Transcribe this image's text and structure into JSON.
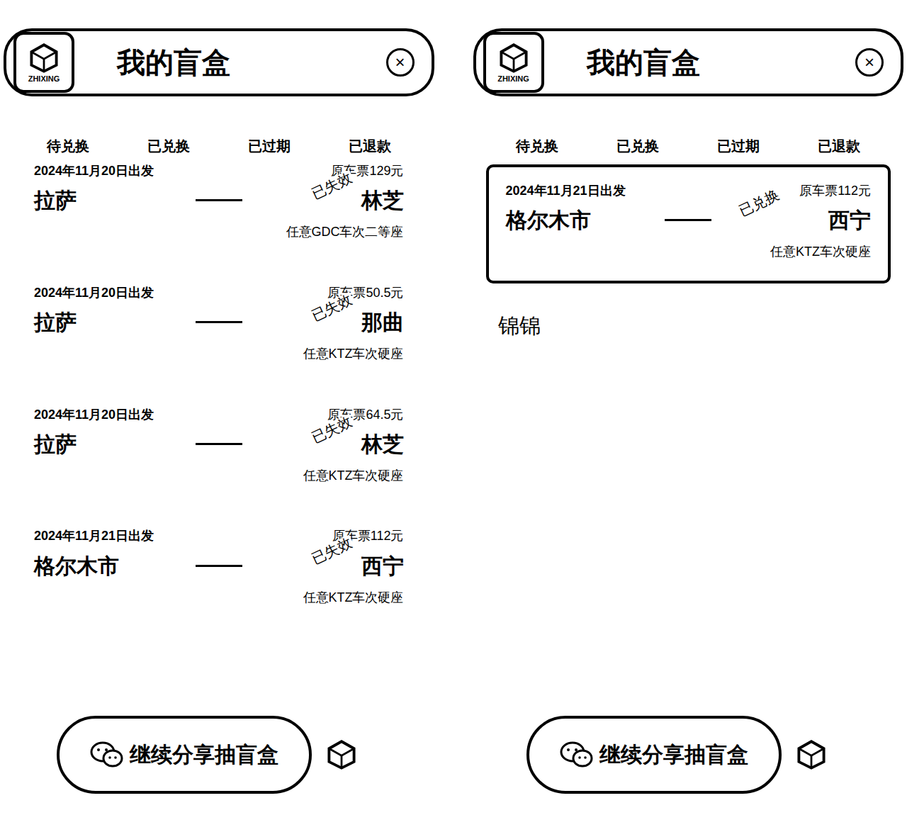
{
  "panels": [
    {
      "header": {
        "logo_text": "ZHIXING",
        "title": "我的盲盒",
        "close": "×"
      },
      "tabs": [
        {
          "label": "待兑换",
          "selected": false
        },
        {
          "label": "已兑换",
          "selected": false
        },
        {
          "label": "已过期",
          "selected": false
        },
        {
          "label": "已退款",
          "selected": false
        }
      ],
      "tickets": [
        {
          "date": "2024年11月20日出发",
          "from": "拉萨",
          "to": "林芝",
          "price": "原车票129元",
          "seat": "任意GDC车次二等座",
          "stamp": "已失效",
          "framed": false
        },
        {
          "date": "2024年11月20日出发",
          "from": "拉萨",
          "to": "那曲",
          "price": "原车票50.5元",
          "seat": "任意KTZ车次硬座",
          "stamp": "已失效",
          "framed": false
        },
        {
          "date": "2024年11月20日出发",
          "from": "拉萨",
          "to": "林芝",
          "price": "原车票64.5元",
          "seat": "任意KTZ车次硬座",
          "stamp": "已失效",
          "framed": false
        },
        {
          "date": "2024年11月21日出发",
          "from": "格尔木市",
          "to": "西宁",
          "price": "原车票112元",
          "seat": "任意KTZ车次硬座",
          "stamp": "已失效",
          "framed": false
        }
      ],
      "note": "",
      "button": "继续分享抽盲盒"
    },
    {
      "header": {
        "logo_text": "ZHIXING",
        "title": "我的盲盒",
        "close": "×"
      },
      "tabs": [
        {
          "label": "待兑换",
          "selected": false
        },
        {
          "label": "已兑换",
          "selected": false
        },
        {
          "label": "已过期",
          "selected": false
        },
        {
          "label": "已退款",
          "selected": false
        }
      ],
      "tickets": [
        {
          "date": "2024年11月21日出发",
          "from": "格尔木市",
          "to": "西宁",
          "price": "原车票112元",
          "seat": "任意KTZ车次硬座",
          "stamp": "已兑换",
          "framed": true
        }
      ],
      "note": "锦锦",
      "button": "继续分享抽盲盒"
    }
  ]
}
